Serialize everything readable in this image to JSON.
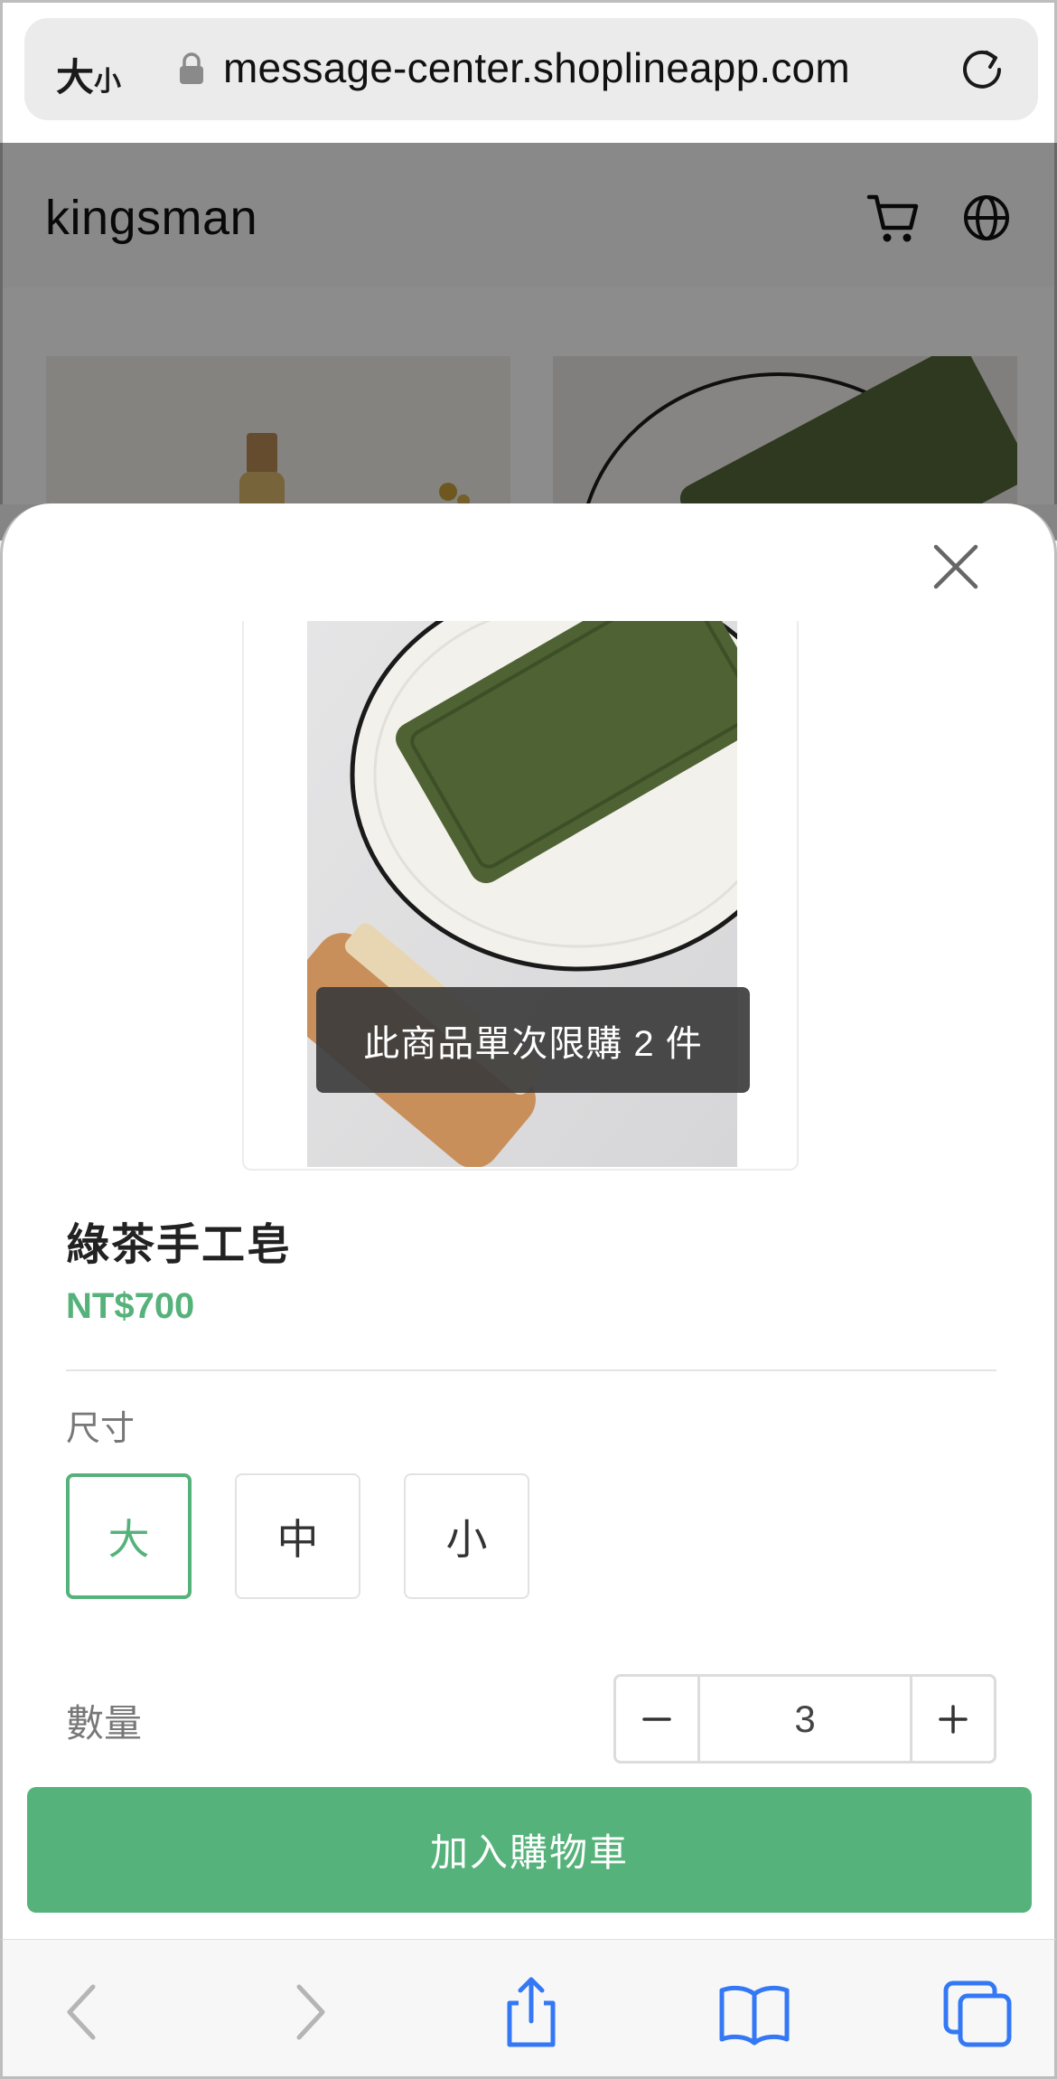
{
  "browser": {
    "text_size_big": "大",
    "text_size_small": "小",
    "url": "message-center.shoplineapp.com"
  },
  "site": {
    "logo": "kingsman"
  },
  "modal": {
    "toast": "此商品單次限購 2 件",
    "product_name": "綠茶手工皂",
    "price": "NT$700",
    "size_label": "尺寸",
    "sizes": [
      "大",
      "中",
      "小"
    ],
    "selected_size": "大",
    "quantity_label": "數量",
    "quantity": "3",
    "add_to_cart": "加入購物車"
  },
  "colors": {
    "accent": "#55b27a",
    "toolbar_blue": "#3478f6"
  },
  "icons": [
    "lock-icon",
    "reload-icon",
    "cart-icon",
    "globe-icon",
    "close-icon",
    "minus-icon",
    "plus-icon",
    "back-icon",
    "forward-icon",
    "share-icon",
    "bookmarks-icon",
    "tabs-icon"
  ]
}
